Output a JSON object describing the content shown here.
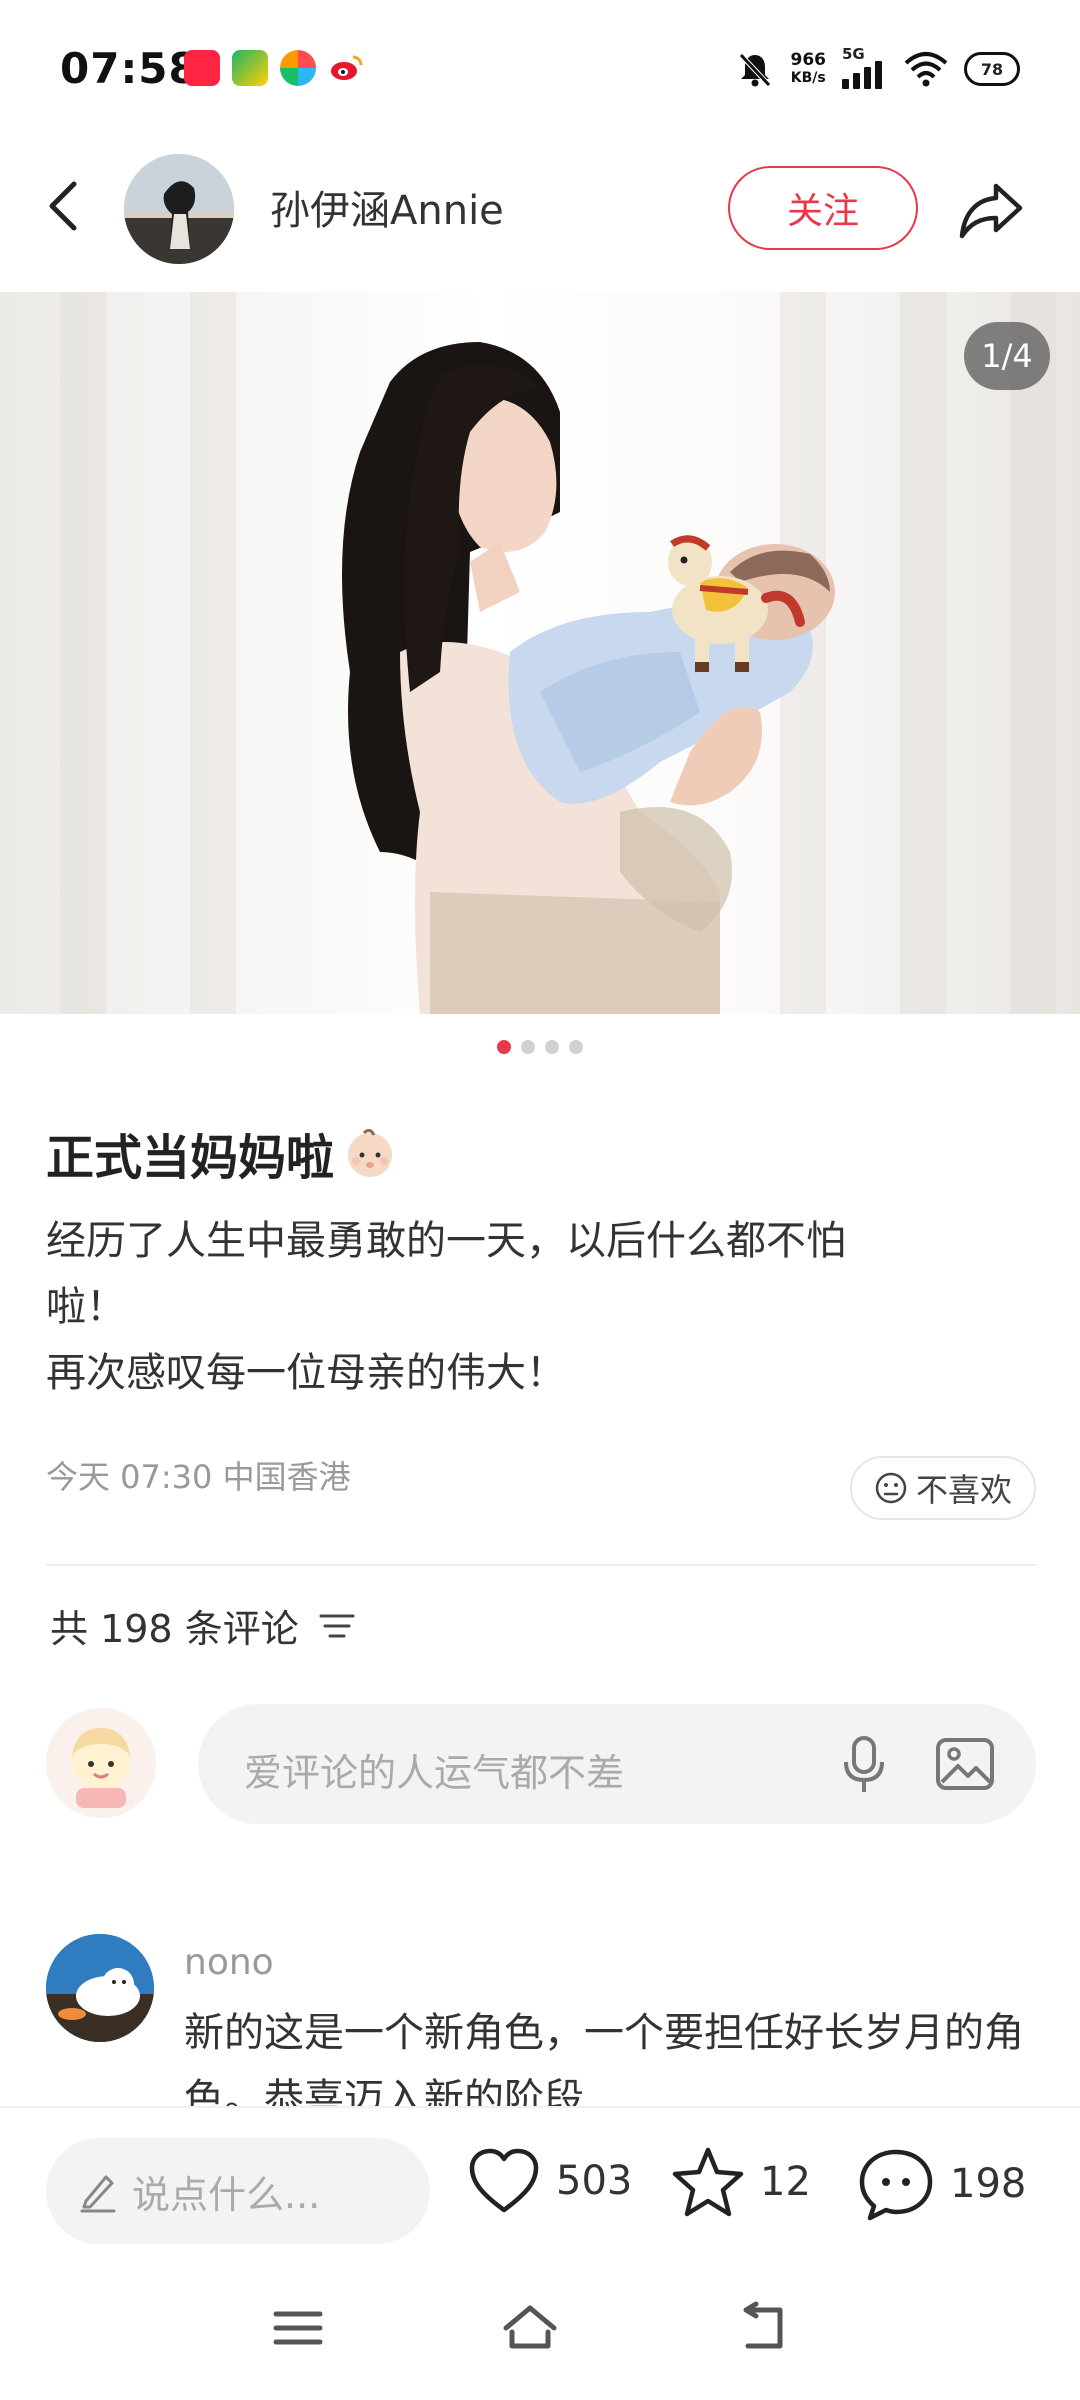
{
  "status_bar": {
    "time": "07:58",
    "net_speed_value": "966",
    "net_speed_unit": "KB/s",
    "network": "5G",
    "battery": "78"
  },
  "header": {
    "username": "孙伊涵Annie",
    "follow_label": "关注"
  },
  "gallery": {
    "counter": "1/4",
    "page_index": 1,
    "page_total": 4
  },
  "post": {
    "title": "正式当妈妈啦",
    "body": "经历了人生中最勇敢的一天，以后什么都不怕\n啦！\n再次感叹每一位母亲的伟大！",
    "meta": "今天 07:30 中国香港",
    "dislike_label": "不喜欢"
  },
  "comments": {
    "count_label": "共 198 条评论",
    "input_placeholder": "爱评论的人运气都不差",
    "items": [
      {
        "author": "nono",
        "text": "新的这是一个新角色，一个要担任好长岁月的角色。恭喜迈入新的阶段"
      }
    ]
  },
  "bottom_bar": {
    "say_placeholder": "说点什么...",
    "likes": "503",
    "stars": "12",
    "comments": "198"
  },
  "colors": {
    "accent": "#e8384a"
  }
}
